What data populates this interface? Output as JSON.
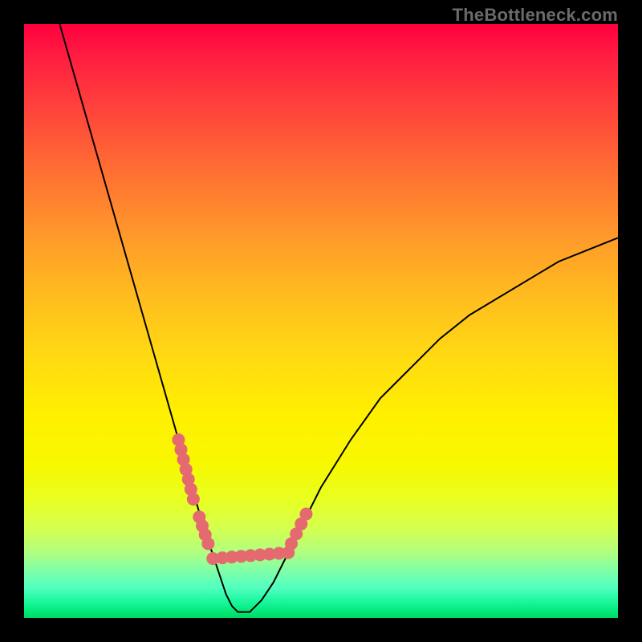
{
  "watermark": "TheBottleneck.com",
  "chart_data": {
    "type": "line",
    "title": "",
    "xlabel": "",
    "ylabel": "",
    "xlim": [
      0,
      100
    ],
    "ylim": [
      0,
      100
    ],
    "grid": false,
    "series": [
      {
        "name": "curve",
        "x": [
          6,
          8,
          10,
          12,
          14,
          16,
          18,
          20,
          22,
          24,
          26,
          28,
          30,
          32,
          33,
          34,
          35,
          36,
          38,
          40,
          42,
          44,
          46,
          48,
          50,
          55,
          60,
          65,
          70,
          75,
          80,
          85,
          90,
          95,
          100
        ],
        "y": [
          100,
          93,
          86,
          79,
          72,
          65,
          58,
          51,
          44,
          37,
          30,
          23,
          16,
          10,
          7,
          4,
          2,
          1,
          1,
          3,
          6,
          10,
          14,
          18,
          22,
          30,
          37,
          42,
          47,
          51,
          54,
          57,
          60,
          62,
          64
        ]
      }
    ],
    "highlight_segments": [
      {
        "x": [
          26.0,
          28.5
        ],
        "y": [
          30.0,
          20.0
        ]
      },
      {
        "x": [
          29.5,
          31.0
        ],
        "y": [
          17.0,
          12.5
        ]
      },
      {
        "x": [
          31.8,
          44.5
        ],
        "y": [
          10.0,
          11.0
        ]
      },
      {
        "x": [
          45.0,
          47.5
        ],
        "y": [
          12.5,
          17.5
        ]
      }
    ],
    "colors": {
      "curve": "#000000",
      "highlight": "#e46a6f",
      "gradient_top": "#ff003f",
      "gradient_bottom": "#00d860"
    }
  }
}
